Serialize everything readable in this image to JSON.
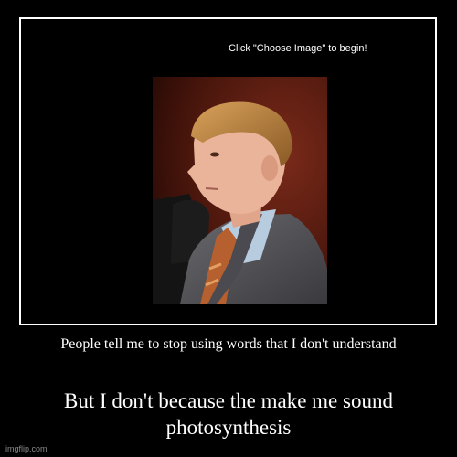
{
  "instruction_text": "Click \"Choose Image\" to begin!",
  "top_caption": "People tell me to stop using words that I don't understand",
  "bottom_caption": "But I don't because the make me sound photosynthesis",
  "watermark": "imgflip.com",
  "colors": {
    "background": "#000000",
    "border": "#ffffff",
    "text": "#ffffff",
    "watermark": "#8a8a8a"
  }
}
